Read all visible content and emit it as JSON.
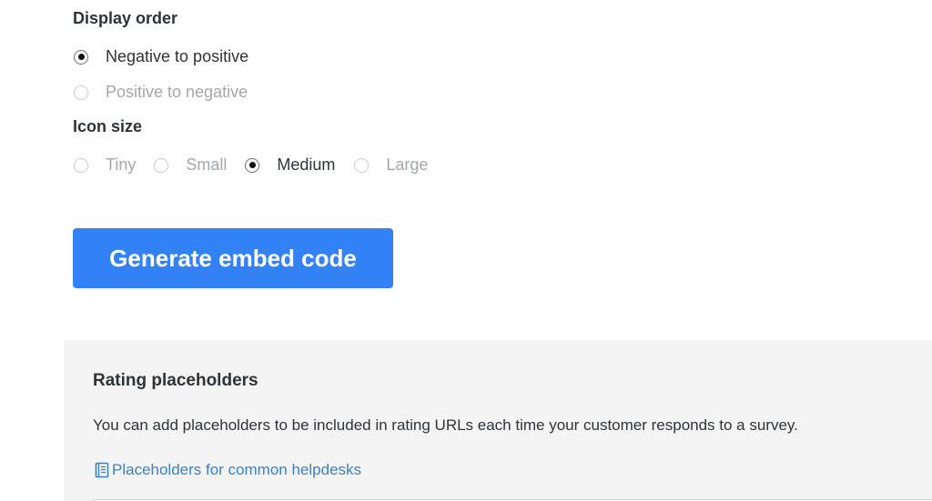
{
  "display_order": {
    "label": "Display order",
    "options": [
      {
        "label": "Negative to positive",
        "selected": true
      },
      {
        "label": "Positive to negative",
        "selected": false
      }
    ]
  },
  "icon_size": {
    "label": "Icon size",
    "options": [
      {
        "label": "Tiny",
        "selected": false
      },
      {
        "label": "Small",
        "selected": false
      },
      {
        "label": "Medium",
        "selected": true
      },
      {
        "label": "Large",
        "selected": false
      }
    ]
  },
  "generate_button": {
    "label": "Generate embed code"
  },
  "placeholders_panel": {
    "title": "Rating placeholders",
    "description": "You can add placeholders to be included in rating URLs each time your customer responds to a survey.",
    "link_label": "Placeholders for common helpdesks",
    "link_icon": "book-icon"
  },
  "colors": {
    "primary_button": "#3282f6",
    "link": "#3a82c4",
    "panel_background": "#f4f4f4",
    "text": "#2e3338",
    "muted_text": "#a3a7ab"
  }
}
